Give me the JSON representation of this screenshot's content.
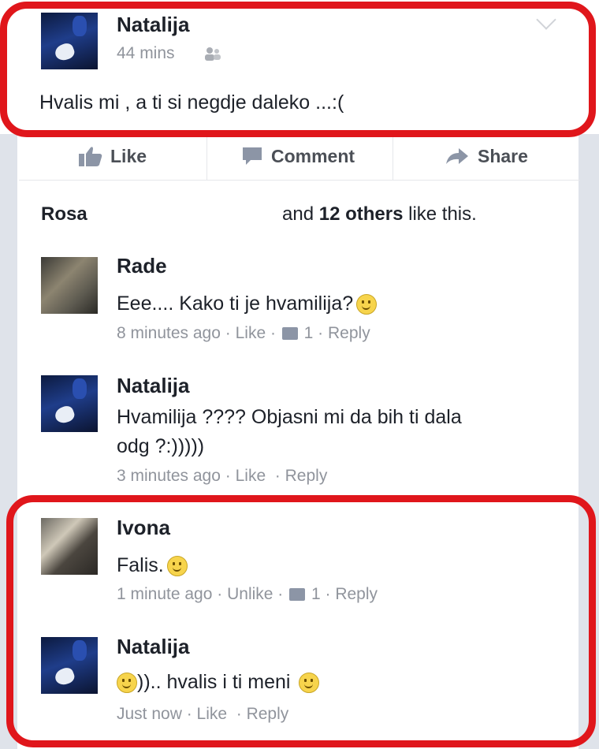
{
  "post": {
    "author": "Natalija",
    "time": "44 mins",
    "text": "Hvalis mi , a ti si negdje daleko ...:("
  },
  "actions": {
    "like": "Like",
    "comment": "Comment",
    "share": "Share"
  },
  "likes": {
    "first": "Rosa",
    "pre": "and",
    "others": "12 others",
    "post": "like this."
  },
  "comments": [
    {
      "author": "Rade",
      "text": "Eee....  Kako ti je hvamilija?",
      "time": "8 minutes ago",
      "like": "Like",
      "like_count": "1",
      "reply": "Reply"
    },
    {
      "author": "Natalija",
      "text_line1": "Hvamilija ???? Objasni mi da bih ti dala",
      "text_line2": "odg ?:)))))",
      "time": "3 minutes ago",
      "like": "Like",
      "reply": "Reply"
    },
    {
      "author": "Ivona",
      "text": "Falis.",
      "time": "1 minute ago",
      "like": "Unlike",
      "like_count": "1",
      "reply": "Reply"
    },
    {
      "author": "Natalija",
      "text_pre": ")).. hvalis i ti meni",
      "time": "Just now",
      "like": "Like",
      "reply": "Reply"
    }
  ],
  "icons": {
    "like": "thumbs-up-icon",
    "comment": "comment-icon",
    "share": "share-arrow-icon",
    "privacy": "friends-icon",
    "menu": "chevron-down-icon",
    "emoji": "smile-emoji-icon"
  },
  "colors": {
    "highlight": "#e0161b",
    "meta": "#90949c",
    "text": "#1d2129"
  }
}
